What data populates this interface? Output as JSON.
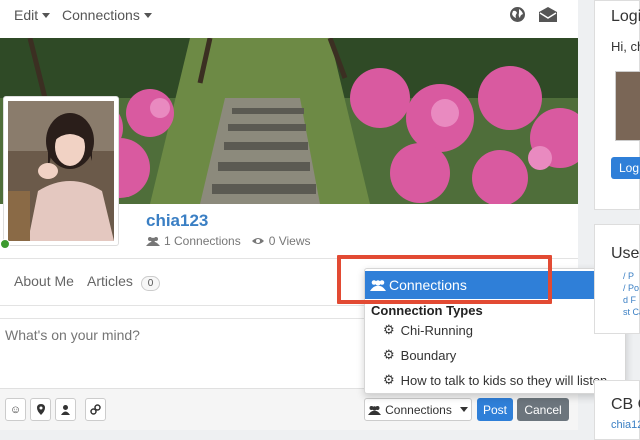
{
  "topbar": {
    "edit_label": "Edit",
    "connections_label": "Connections",
    "globe_icon": "globe-icon",
    "mail_icon": "envelope-icon"
  },
  "profile": {
    "username": "chia123",
    "connections_count": "1 Connections",
    "views_count": "0 Views"
  },
  "tabs": [
    {
      "label": "About Me"
    },
    {
      "label": "Articles",
      "badge": "0"
    }
  ],
  "status": {
    "placeholder": "What's on your mind?"
  },
  "toolbar": {
    "connections_label": "Connections",
    "post_label": "Post",
    "cancel_label": "Cancel"
  },
  "dropdown": {
    "header": "Connections",
    "section_title": "Connection Types",
    "items": [
      {
        "label": "Chi-Running"
      },
      {
        "label": "Boundary"
      },
      {
        "label": "How to talk to kids so they will listen"
      }
    ]
  },
  "right": {
    "login_title": "Logi",
    "greeting": "Hi, ch",
    "login_button": "Log",
    "users_title": "User",
    "cb_title": "CB C",
    "cb_link": "chia12",
    "snippets": [
      "/ P",
      "/ Po",
      "d F",
      "st Ca"
    ]
  },
  "colors": {
    "accent": "#2f7fd8",
    "link": "#3a7fc4",
    "highlight_border": "#e24a33",
    "cancel": "#6c757d",
    "online": "#3c9a2e"
  }
}
